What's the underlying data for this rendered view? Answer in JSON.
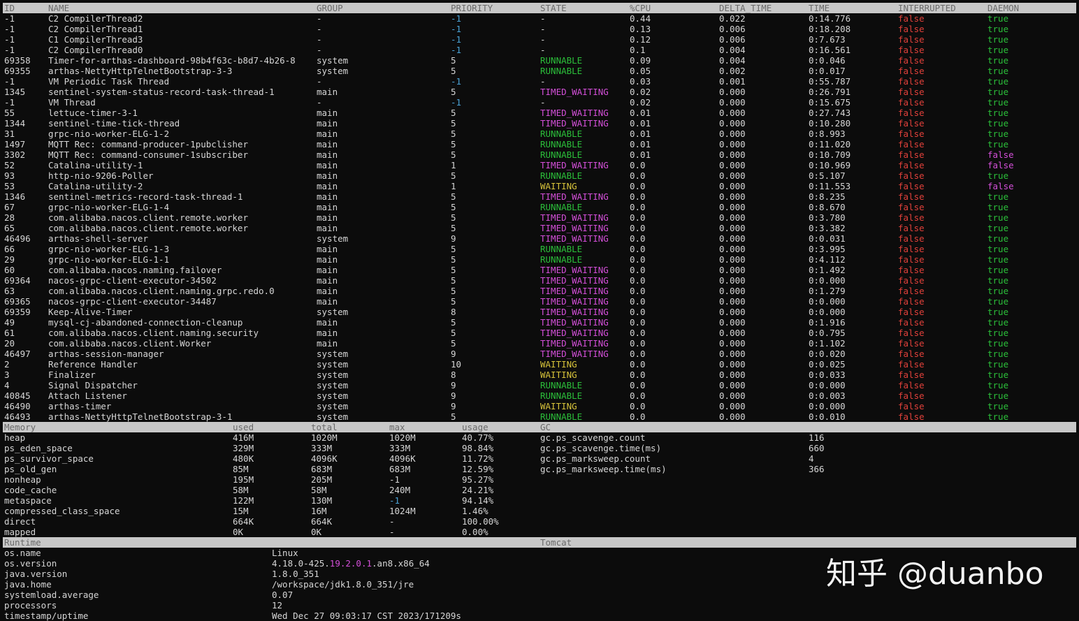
{
  "threads": {
    "columns": [
      "ID",
      "NAME",
      "GROUP",
      "PRIORITY",
      "STATE",
      "%CPU",
      "DELTA_TIME",
      "TIME",
      "INTERRUPTED",
      "DAEMON"
    ],
    "rows": [
      {
        "id": "-1",
        "name": "C2 CompilerThread2",
        "group": "-",
        "priority": "-1",
        "state": "-",
        "cpu": "0.44",
        "delta": "0.022",
        "time": "0:14.776",
        "interrupted": "false",
        "daemon": "true"
      },
      {
        "id": "-1",
        "name": "C2 CompilerThread1",
        "group": "-",
        "priority": "-1",
        "state": "-",
        "cpu": "0.13",
        "delta": "0.006",
        "time": "0:18.208",
        "interrupted": "false",
        "daemon": "true"
      },
      {
        "id": "-1",
        "name": "C1 CompilerThread3",
        "group": "-",
        "priority": "-1",
        "state": "-",
        "cpu": "0.12",
        "delta": "0.006",
        "time": "0:7.673",
        "interrupted": "false",
        "daemon": "true"
      },
      {
        "id": "-1",
        "name": "C2 CompilerThread0",
        "group": "-",
        "priority": "-1",
        "state": "-",
        "cpu": "0.1",
        "delta": "0.004",
        "time": "0:16.561",
        "interrupted": "false",
        "daemon": "true"
      },
      {
        "id": "69358",
        "name": "Timer-for-arthas-dashboard-98b4f63c-b8d7-4b26-8",
        "group": "system",
        "priority": "5",
        "state": "RUNNABLE",
        "cpu": "0.09",
        "delta": "0.004",
        "time": "0:0.046",
        "interrupted": "false",
        "daemon": "true"
      },
      {
        "id": "69355",
        "name": "arthas-NettyHttpTelnetBootstrap-3-3",
        "group": "system",
        "priority": "5",
        "state": "RUNNABLE",
        "cpu": "0.05",
        "delta": "0.002",
        "time": "0:0.017",
        "interrupted": "false",
        "daemon": "true"
      },
      {
        "id": "-1",
        "name": "VM Periodic Task Thread",
        "group": "-",
        "priority": "-1",
        "state": "-",
        "cpu": "0.03",
        "delta": "0.001",
        "time": "0:55.787",
        "interrupted": "false",
        "daemon": "true"
      },
      {
        "id": "1345",
        "name": "sentinel-system-status-record-task-thread-1",
        "group": "main",
        "priority": "5",
        "state": "TIMED_WAITING",
        "cpu": "0.02",
        "delta": "0.000",
        "time": "0:26.791",
        "interrupted": "false",
        "daemon": "true"
      },
      {
        "id": "-1",
        "name": "VM Thread",
        "group": "-",
        "priority": "-1",
        "state": "-",
        "cpu": "0.02",
        "delta": "0.000",
        "time": "0:15.675",
        "interrupted": "false",
        "daemon": "true"
      },
      {
        "id": "55",
        "name": "lettuce-timer-3-1",
        "group": "main",
        "priority": "5",
        "state": "TIMED_WAITING",
        "cpu": "0.01",
        "delta": "0.000",
        "time": "0:27.743",
        "interrupted": "false",
        "daemon": "true"
      },
      {
        "id": "1344",
        "name": "sentinel-time-tick-thread",
        "group": "main",
        "priority": "5",
        "state": "TIMED_WAITING",
        "cpu": "0.01",
        "delta": "0.000",
        "time": "0:10.280",
        "interrupted": "false",
        "daemon": "true"
      },
      {
        "id": "31",
        "name": "grpc-nio-worker-ELG-1-2",
        "group": "main",
        "priority": "5",
        "state": "RUNNABLE",
        "cpu": "0.01",
        "delta": "0.000",
        "time": "0:8.993",
        "interrupted": "false",
        "daemon": "true"
      },
      {
        "id": "1497",
        "name": "MQTT Rec: command-producer-1pubclisher",
        "group": "main",
        "priority": "5",
        "state": "RUNNABLE",
        "cpu": "0.01",
        "delta": "0.000",
        "time": "0:11.020",
        "interrupted": "false",
        "daemon": "true"
      },
      {
        "id": "3302",
        "name": "MQTT Rec: command-consumer-1subscriber",
        "group": "main",
        "priority": "5",
        "state": "RUNNABLE",
        "cpu": "0.01",
        "delta": "0.000",
        "time": "0:10.709",
        "interrupted": "false",
        "daemon": "false"
      },
      {
        "id": "52",
        "name": "Catalina-utility-1",
        "group": "main",
        "priority": "1",
        "state": "TIMED_WAITING",
        "cpu": "0.0",
        "delta": "0.000",
        "time": "0:10.969",
        "interrupted": "false",
        "daemon": "false"
      },
      {
        "id": "93",
        "name": "http-nio-9206-Poller",
        "group": "main",
        "priority": "5",
        "state": "RUNNABLE",
        "cpu": "0.0",
        "delta": "0.000",
        "time": "0:5.107",
        "interrupted": "false",
        "daemon": "true"
      },
      {
        "id": "53",
        "name": "Catalina-utility-2",
        "group": "main",
        "priority": "1",
        "state": "WAITING",
        "cpu": "0.0",
        "delta": "0.000",
        "time": "0:11.553",
        "interrupted": "false",
        "daemon": "false"
      },
      {
        "id": "1346",
        "name": "sentinel-metrics-record-task-thread-1",
        "group": "main",
        "priority": "5",
        "state": "TIMED_WAITING",
        "cpu": "0.0",
        "delta": "0.000",
        "time": "0:8.235",
        "interrupted": "false",
        "daemon": "true"
      },
      {
        "id": "67",
        "name": "grpc-nio-worker-ELG-1-4",
        "group": "main",
        "priority": "5",
        "state": "RUNNABLE",
        "cpu": "0.0",
        "delta": "0.000",
        "time": "0:8.670",
        "interrupted": "false",
        "daemon": "true"
      },
      {
        "id": "28",
        "name": "com.alibaba.nacos.client.remote.worker",
        "group": "main",
        "priority": "5",
        "state": "TIMED_WAITING",
        "cpu": "0.0",
        "delta": "0.000",
        "time": "0:3.780",
        "interrupted": "false",
        "daemon": "true"
      },
      {
        "id": "65",
        "name": "com.alibaba.nacos.client.remote.worker",
        "group": "main",
        "priority": "5",
        "state": "TIMED_WAITING",
        "cpu": "0.0",
        "delta": "0.000",
        "time": "0:3.382",
        "interrupted": "false",
        "daemon": "true"
      },
      {
        "id": "46496",
        "name": "arthas-shell-server",
        "group": "system",
        "priority": "9",
        "state": "TIMED_WAITING",
        "cpu": "0.0",
        "delta": "0.000",
        "time": "0:0.031",
        "interrupted": "false",
        "daemon": "true"
      },
      {
        "id": "66",
        "name": "grpc-nio-worker-ELG-1-3",
        "group": "main",
        "priority": "5",
        "state": "RUNNABLE",
        "cpu": "0.0",
        "delta": "0.000",
        "time": "0:3.995",
        "interrupted": "false",
        "daemon": "true"
      },
      {
        "id": "29",
        "name": "grpc-nio-worker-ELG-1-1",
        "group": "main",
        "priority": "5",
        "state": "RUNNABLE",
        "cpu": "0.0",
        "delta": "0.000",
        "time": "0:4.112",
        "interrupted": "false",
        "daemon": "true"
      },
      {
        "id": "60",
        "name": "com.alibaba.nacos.naming.failover",
        "group": "main",
        "priority": "5",
        "state": "TIMED_WAITING",
        "cpu": "0.0",
        "delta": "0.000",
        "time": "0:1.492",
        "interrupted": "false",
        "daemon": "true"
      },
      {
        "id": "69364",
        "name": "nacos-grpc-client-executor-34502",
        "group": "main",
        "priority": "5",
        "state": "TIMED_WAITING",
        "cpu": "0.0",
        "delta": "0.000",
        "time": "0:0.000",
        "interrupted": "false",
        "daemon": "true"
      },
      {
        "id": "63",
        "name": "com.alibaba.nacos.client.naming.grpc.redo.0",
        "group": "main",
        "priority": "5",
        "state": "TIMED_WAITING",
        "cpu": "0.0",
        "delta": "0.000",
        "time": "0:1.279",
        "interrupted": "false",
        "daemon": "true"
      },
      {
        "id": "69365",
        "name": "nacos-grpc-client-executor-34487",
        "group": "main",
        "priority": "5",
        "state": "TIMED_WAITING",
        "cpu": "0.0",
        "delta": "0.000",
        "time": "0:0.000",
        "interrupted": "false",
        "daemon": "true"
      },
      {
        "id": "69359",
        "name": "Keep-Alive-Timer",
        "group": "system",
        "priority": "8",
        "state": "TIMED_WAITING",
        "cpu": "0.0",
        "delta": "0.000",
        "time": "0:0.000",
        "interrupted": "false",
        "daemon": "true"
      },
      {
        "id": "49",
        "name": "mysql-cj-abandoned-connection-cleanup",
        "group": "main",
        "priority": "5",
        "state": "TIMED_WAITING",
        "cpu": "0.0",
        "delta": "0.000",
        "time": "0:1.916",
        "interrupted": "false",
        "daemon": "true"
      },
      {
        "id": "61",
        "name": "com.alibaba.nacos.client.naming.security",
        "group": "main",
        "priority": "5",
        "state": "TIMED_WAITING",
        "cpu": "0.0",
        "delta": "0.000",
        "time": "0:0.795",
        "interrupted": "false",
        "daemon": "true"
      },
      {
        "id": "20",
        "name": "com.alibaba.nacos.client.Worker",
        "group": "main",
        "priority": "5",
        "state": "TIMED_WAITING",
        "cpu": "0.0",
        "delta": "0.000",
        "time": "0:1.102",
        "interrupted": "false",
        "daemon": "true"
      },
      {
        "id": "46497",
        "name": "arthas-session-manager",
        "group": "system",
        "priority": "9",
        "state": "TIMED_WAITING",
        "cpu": "0.0",
        "delta": "0.000",
        "time": "0:0.020",
        "interrupted": "false",
        "daemon": "true"
      },
      {
        "id": "2",
        "name": "Reference Handler",
        "group": "system",
        "priority": "10",
        "state": "WAITING",
        "cpu": "0.0",
        "delta": "0.000",
        "time": "0:0.025",
        "interrupted": "false",
        "daemon": "true"
      },
      {
        "id": "3",
        "name": "Finalizer",
        "group": "system",
        "priority": "8",
        "state": "WAITING",
        "cpu": "0.0",
        "delta": "0.000",
        "time": "0:0.033",
        "interrupted": "false",
        "daemon": "true"
      },
      {
        "id": "4",
        "name": "Signal Dispatcher",
        "group": "system",
        "priority": "9",
        "state": "RUNNABLE",
        "cpu": "0.0",
        "delta": "0.000",
        "time": "0:0.000",
        "interrupted": "false",
        "daemon": "true"
      },
      {
        "id": "40845",
        "name": "Attach Listener",
        "group": "system",
        "priority": "9",
        "state": "RUNNABLE",
        "cpu": "0.0",
        "delta": "0.000",
        "time": "0:0.003",
        "interrupted": "false",
        "daemon": "true"
      },
      {
        "id": "46490",
        "name": "arthas-timer",
        "group": "system",
        "priority": "9",
        "state": "WAITING",
        "cpu": "0.0",
        "delta": "0.000",
        "time": "0:0.000",
        "interrupted": "false",
        "daemon": "true"
      },
      {
        "id": "46493",
        "name": "arthas-NettyHttpTelnetBootstrap-3-1",
        "group": "system",
        "priority": "5",
        "state": "RUNNABLE",
        "cpu": "0.0",
        "delta": "0.000",
        "time": "0:0.010",
        "interrupted": "false",
        "daemon": "true"
      }
    ]
  },
  "memory": {
    "columns": [
      "Memory",
      "used",
      "total",
      "max",
      "usage"
    ],
    "rows": [
      {
        "name": "heap",
        "used": "416M",
        "total": "1020M",
        "max": "1020M",
        "usage": "40.77%"
      },
      {
        "name": "ps_eden_space",
        "used": "329M",
        "total": "333M",
        "max": "333M",
        "usage": "98.84%"
      },
      {
        "name": "ps_survivor_space",
        "used": "480K",
        "total": "4096K",
        "max": "4096K",
        "usage": "11.72%"
      },
      {
        "name": "ps_old_gen",
        "used": "85M",
        "total": "683M",
        "max": "683M",
        "usage": "12.59%"
      },
      {
        "name": "nonheap",
        "used": "195M",
        "total": "205M",
        "max": "-1",
        "usage": "95.27%"
      },
      {
        "name": "code_cache",
        "used": "58M",
        "total": "58M",
        "max": "240M",
        "usage": "24.21%"
      },
      {
        "name": "metaspace",
        "used": "122M",
        "total": "130M",
        "max": "-1",
        "usage": "94.14%"
      },
      {
        "name": "compressed_class_space",
        "used": "15M",
        "total": "16M",
        "max": "1024M",
        "usage": "1.46%"
      },
      {
        "name": "direct",
        "used": "664K",
        "total": "664K",
        "max": "-",
        "usage": "100.00%"
      },
      {
        "name": "mapped",
        "used": "0K",
        "total": "0K",
        "max": "-",
        "usage": "0.00%"
      }
    ]
  },
  "gc": {
    "header": "GC",
    "rows": [
      {
        "name": "gc.ps_scavenge.count",
        "value": "116"
      },
      {
        "name": "gc.ps_scavenge.time(ms)",
        "value": "660"
      },
      {
        "name": "gc.ps_marksweep.count",
        "value": "4"
      },
      {
        "name": "gc.ps_marksweep.time(ms)",
        "value": "366"
      }
    ]
  },
  "runtime": {
    "header": "Runtime",
    "tomcat_header": "Tomcat",
    "rows": [
      {
        "name": "os.name",
        "value": "Linux"
      },
      {
        "name": "os.version",
        "value_parts": [
          "4.18.0-425.",
          "19.2.0.1",
          ".an8.x86_64"
        ]
      },
      {
        "name": "java.version",
        "value": "1.8.0_351"
      },
      {
        "name": "java.home",
        "value": "/workspace/jdk1.8.0_351/jre"
      },
      {
        "name": "systemload.average",
        "value": "0.07"
      },
      {
        "name": "processors",
        "value": "12"
      },
      {
        "name": "timestamp/uptime",
        "value": "Wed Dec 27 09:03:17 CST 2023/171209s"
      }
    ]
  },
  "watermark": "知乎 @duanbo",
  "colors": {
    "header_bg": "#c8c8c8",
    "header_fg": "#6a6a6a",
    "runnable": "#2bbf3a",
    "timed_waiting": "#d34fd8",
    "waiting": "#d6c23a",
    "priority_neg": "#4aa3d6",
    "interrupted_false": "#e0403a",
    "daemon_true": "#2bbf3a",
    "daemon_false": "#d34fd8"
  }
}
